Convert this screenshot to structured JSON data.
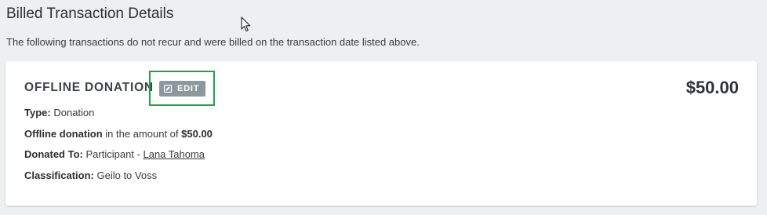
{
  "section": {
    "title": "Billed Transaction Details",
    "description": "The following transactions do not recur and were billed on the transaction date listed above."
  },
  "transaction": {
    "title": "OFFLINE DONATION",
    "edit_label": "EDIT",
    "edit_icon": "edit-icon",
    "amount": "$50.00",
    "type_label": "Type:",
    "type_value": "Donation",
    "offline_label": "Offline donation",
    "offline_text": "in the amount of",
    "offline_amount": "$50.00",
    "donated_to_label": "Donated To:",
    "donated_to_prefix": "Participant -",
    "participant_name": "Lana Tahoma",
    "classification_label": "Classification:",
    "classification_value": "Geilo to Voss"
  },
  "colors": {
    "background": "#edeff0",
    "card": "#ffffff",
    "edit_button": "#8e979d",
    "highlight": "#1fa34a",
    "heading": "#3d4449"
  }
}
